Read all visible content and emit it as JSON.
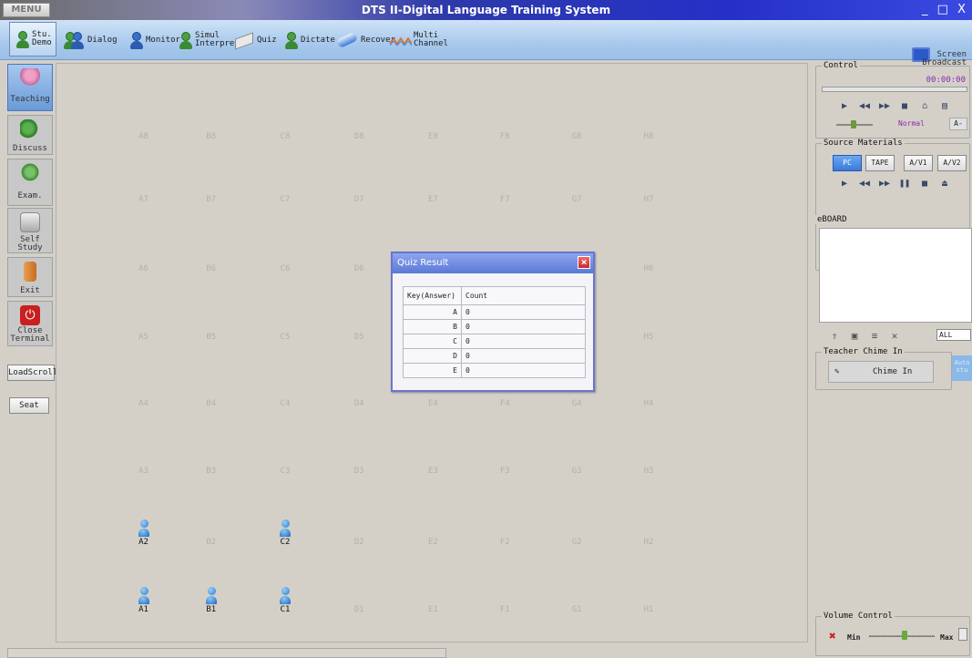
{
  "app": {
    "title": "DTS II-Digital Language Training System",
    "menu_label": "MENU",
    "window_controls": "_ □ X"
  },
  "toolbar": {
    "items": [
      {
        "id": "stu-demo",
        "label": "Stu.\nDemo",
        "icon": "student-demo-icon"
      },
      {
        "id": "dialog",
        "label": "Dialog",
        "icon": "dialog-icon"
      },
      {
        "id": "monitor",
        "label": "Monitor",
        "icon": "monitor-icon"
      },
      {
        "id": "simul",
        "label": "Simul\nInterpret",
        "icon": "interpret-icon"
      },
      {
        "id": "quiz",
        "label": "Quiz",
        "icon": "quiz-icon"
      },
      {
        "id": "dictate",
        "label": "Dictate",
        "icon": "dictate-icon"
      },
      {
        "id": "recover",
        "label": "Recover",
        "icon": "recover-icon"
      },
      {
        "id": "multi",
        "label": "Multi\nChannel",
        "icon": "multi-channel-icon"
      }
    ],
    "screen_broadcast": "Screen\nBroadcast"
  },
  "leftbar": {
    "modes": [
      {
        "id": "teaching",
        "label": "Teaching",
        "active": true
      },
      {
        "id": "discuss",
        "label": "Discuss",
        "active": false
      },
      {
        "id": "exam",
        "label": "Exam.",
        "active": false
      },
      {
        "id": "self-study",
        "label": "Self\nStudy",
        "active": false
      },
      {
        "id": "exit",
        "label": "Exit",
        "active": false
      },
      {
        "id": "close-terminal",
        "label": "Close\nTerminal",
        "active": false
      }
    ],
    "load_scroll": "LoadScroll",
    "seat": "Seat"
  },
  "seating": {
    "columns": [
      "A",
      "B",
      "C",
      "D",
      "E",
      "F",
      "G",
      "H"
    ],
    "rows": [
      8,
      7,
      6,
      5,
      4,
      3,
      2,
      1
    ],
    "occupied": [
      "A2",
      "C2",
      "A1",
      "B1",
      "C1"
    ]
  },
  "quiz_result": {
    "title": "Quiz Result",
    "headers": [
      "Key(Answer)",
      "Count"
    ],
    "rows": [
      {
        "key": "A",
        "count": "0"
      },
      {
        "key": "B",
        "count": "0"
      },
      {
        "key": "C",
        "count": "0"
      },
      {
        "key": "D",
        "count": "0"
      },
      {
        "key": "E",
        "count": "0"
      }
    ]
  },
  "control": {
    "title": "Control",
    "timer": "00:00:00",
    "speed_label": "Normal",
    "font_button": "A-"
  },
  "source_materials": {
    "title": "Source Materials",
    "sources": [
      {
        "label": "PC",
        "selected": true
      },
      {
        "label": "TAPE",
        "selected": false
      },
      {
        "label": "A/V1",
        "selected": false
      },
      {
        "label": "A/V2",
        "selected": false
      }
    ]
  },
  "eboard": {
    "title": "eBOARD",
    "filter": "ALL"
  },
  "chime": {
    "title": "Teacher Chime In",
    "button": "Chime In",
    "side_button": "Auto\nstu"
  },
  "volume": {
    "title": "Volume Control",
    "min": "Min",
    "max": "Max",
    "level": 0.55
  },
  "colors": {
    "title_bar": "#2530c8",
    "toolbar": "#a8c8ec",
    "occupied_seat": "#2a7ad0",
    "quiz_header": "#5a78d8"
  }
}
